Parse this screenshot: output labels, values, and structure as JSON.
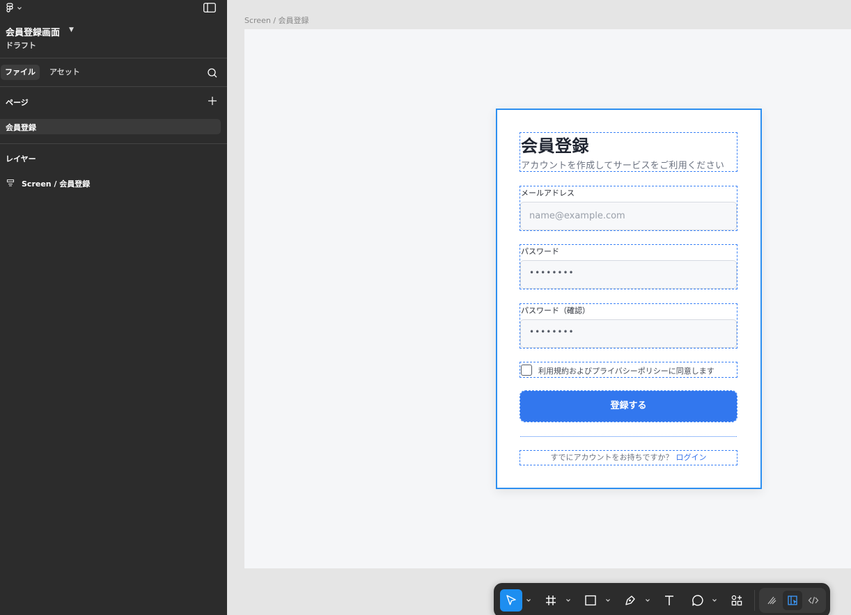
{
  "app": {
    "file_title": "会員登録画面",
    "file_status": "ドラフト"
  },
  "sidebar": {
    "tabs": [
      {
        "label": "ファイル",
        "active": true
      },
      {
        "label": "アセット",
        "active": false
      }
    ],
    "pages_label": "ページ",
    "pages": [
      {
        "label": "会員登録",
        "selected": true
      }
    ],
    "layers_label": "レイヤー",
    "layers": [
      {
        "label": "Screen / 会員登録",
        "icon": "frame-layer-icon"
      }
    ]
  },
  "canvas": {
    "frame_label": "Screen / 会員登録",
    "form": {
      "title": "会員登録",
      "subtitle": "アカウントを作成してサービスをご利用ください",
      "fields": [
        {
          "label": "メールアドレス",
          "placeholder": "name@example.com",
          "value": ""
        },
        {
          "label": "パスワード",
          "placeholder": "••••••••",
          "value": ""
        },
        {
          "label": "パスワード（確認）",
          "placeholder": "••••••••",
          "value": ""
        }
      ],
      "agree_label": "利用規約およびプライバシーポリシーに同意します",
      "agree_checked": false,
      "submit_label": "登録する",
      "login_prompt": "すでにアカウントをお持ちですか？",
      "login_link": "ログイン"
    }
  },
  "toolbar": {
    "tools": [
      {
        "name": "move-tool",
        "active": true
      },
      {
        "name": "frame-tool",
        "active": false
      },
      {
        "name": "rectangle-tool",
        "active": false
      },
      {
        "name": "pen-tool",
        "active": false
      },
      {
        "name": "text-tool",
        "active": false
      },
      {
        "name": "comment-tool",
        "active": false
      },
      {
        "name": "actions-tool",
        "active": false
      }
    ],
    "modes": [
      {
        "name": "draw-mode",
        "active": false
      },
      {
        "name": "design-mode",
        "active": true
      },
      {
        "name": "dev-mode",
        "active": false
      }
    ]
  },
  "colors": {
    "selection": "#2d8ff0",
    "primary_button": "#3277ee",
    "sidebar_bg": "#2c2c2c",
    "link": "#3270ea"
  }
}
